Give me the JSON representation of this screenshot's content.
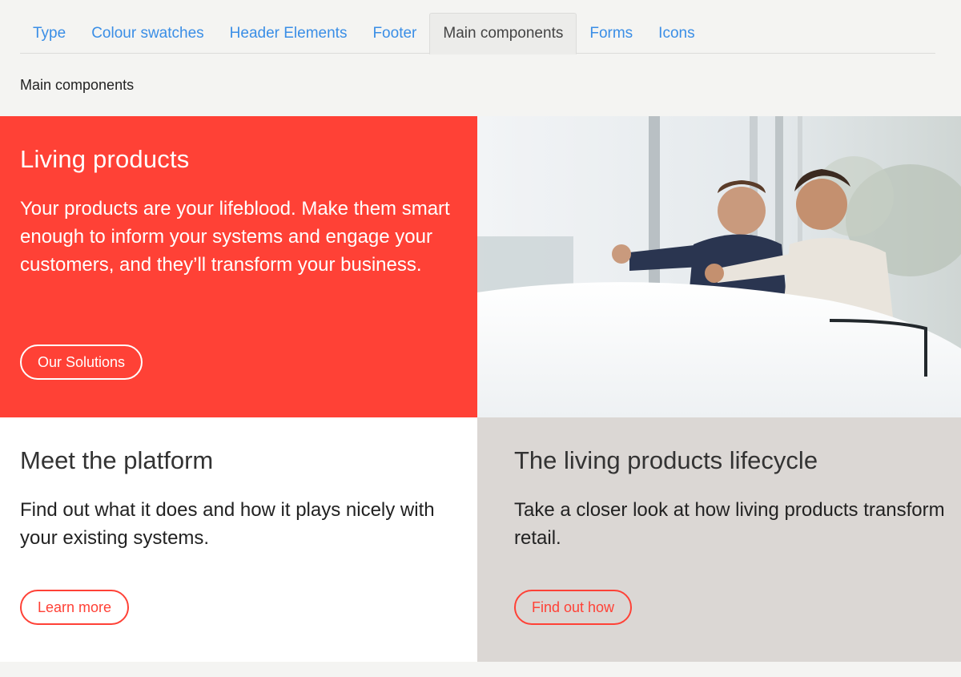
{
  "tabs": [
    {
      "label": "Type",
      "active": false
    },
    {
      "label": "Colour swatches",
      "active": false
    },
    {
      "label": "Header Elements",
      "active": false
    },
    {
      "label": "Footer",
      "active": false
    },
    {
      "label": "Main components",
      "active": true
    },
    {
      "label": "Forms",
      "active": false
    },
    {
      "label": "Icons",
      "active": false
    }
  ],
  "section_label": "Main components",
  "hero": {
    "title": "Living products",
    "text": "Your products are your lifeblood. Make them smart enough to inform your systems and engage your customers, and they’ll transform your business.",
    "button": "Our Solutions"
  },
  "photo": {
    "alt": "Two men in suits pointing at a car in a showroom"
  },
  "platform": {
    "title": "Meet the platform",
    "text": "Find out what it does and how it plays nicely with your existing systems.",
    "button": "Learn more"
  },
  "lifecycle": {
    "title": "The living products lifecycle",
    "text": "Take a closer look at how living products transform retail.",
    "button": "Find out how"
  },
  "colors": {
    "accent": "#ff4136",
    "link": "#3a8ee6",
    "grey_card": "#dbd7d4",
    "page_bg": "#f4f4f2"
  }
}
